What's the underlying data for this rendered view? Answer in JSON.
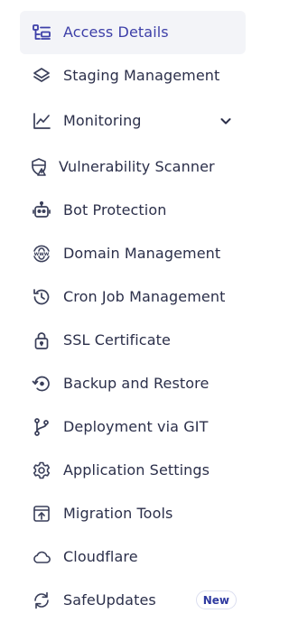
{
  "colors": {
    "active_bg": "#f3f4f8",
    "active_text": "#3d3fa8",
    "text": "#2b2f4a",
    "icon": "#3a3f5a",
    "badge_text": "#2f3aa0"
  },
  "sidebar": {
    "items": [
      {
        "label": "Access Details",
        "icon": "access-details-icon",
        "active": true
      },
      {
        "label": "Staging Management",
        "icon": "layers-icon"
      },
      {
        "label": "Monitoring",
        "icon": "chart-line-icon",
        "expandable": true,
        "chevron_icon": "chevron-down-icon"
      },
      {
        "label": "Vulnerability Scanner",
        "icon": "shield-warning-icon"
      },
      {
        "label": "Bot Protection",
        "icon": "robot-icon"
      },
      {
        "label": "Domain Management",
        "icon": "www-globe-icon"
      },
      {
        "label": "Cron Job Management",
        "icon": "history-clock-icon"
      },
      {
        "label": "SSL Certificate",
        "icon": "lock-icon"
      },
      {
        "label": "Backup and Restore",
        "icon": "backup-restore-icon"
      },
      {
        "label": "Deployment via GIT",
        "icon": "git-branch-icon"
      },
      {
        "label": "Application Settings",
        "icon": "gear-icon"
      },
      {
        "label": "Migration Tools",
        "icon": "upload-box-icon"
      },
      {
        "label": "Cloudflare",
        "icon": "cloud-icon"
      },
      {
        "label": "SafeUpdates",
        "icon": "refresh-icon",
        "badge": "New"
      }
    ]
  }
}
